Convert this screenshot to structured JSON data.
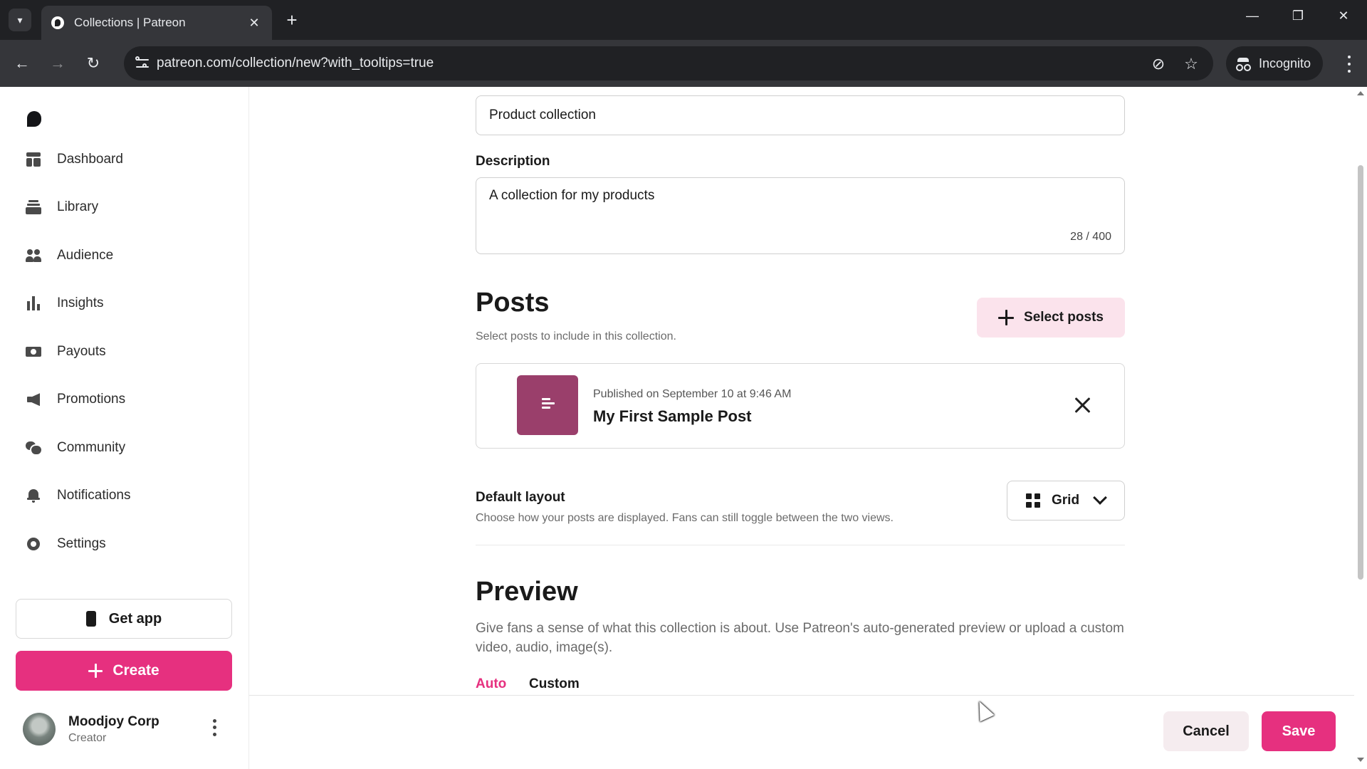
{
  "browser": {
    "tab_title": "Collections | Patreon",
    "url": "patreon.com/collection/new?with_tooltips=true",
    "incognito_label": "Incognito"
  },
  "sidebar": {
    "items": [
      {
        "label": "Dashboard",
        "icon": "dashboard-icon"
      },
      {
        "label": "Library",
        "icon": "library-icon"
      },
      {
        "label": "Audience",
        "icon": "audience-icon"
      },
      {
        "label": "Insights",
        "icon": "insights-icon"
      },
      {
        "label": "Payouts",
        "icon": "payouts-icon"
      },
      {
        "label": "Promotions",
        "icon": "promotions-icon"
      },
      {
        "label": "Community",
        "icon": "community-icon"
      },
      {
        "label": "Notifications",
        "icon": "notifications-icon"
      },
      {
        "label": "Settings",
        "icon": "settings-icon"
      }
    ],
    "get_app_label": "Get app",
    "create_label": "Create",
    "profile": {
      "name": "Moodjoy Corp",
      "role": "Creator"
    }
  },
  "form": {
    "title_value": "Product collection",
    "description_label": "Description",
    "description_value": "A collection for my products",
    "description_counter": "28 / 400"
  },
  "posts": {
    "heading": "Posts",
    "subtitle": "Select posts to include in this collection.",
    "select_label": "Select posts",
    "items": [
      {
        "date": "Published on September 10 at 9:46 AM",
        "title": "My First Sample Post"
      }
    ]
  },
  "layout": {
    "label": "Default layout",
    "hint": "Choose how your posts are displayed. Fans can still toggle between the two views.",
    "selected": "Grid"
  },
  "preview": {
    "heading": "Preview",
    "description": "Give fans a sense of what this collection is about. Use Patreon's auto-generated preview or upload a custom video, audio, image(s).",
    "tabs": [
      "Auto",
      "Custom"
    ],
    "active_tab": "Auto"
  },
  "actions": {
    "cancel_label": "Cancel",
    "save_label": "Save"
  },
  "colors": {
    "accent": "#e6307f",
    "accent_soft": "#fbe3ec",
    "thumb": "#9a3f6b"
  }
}
